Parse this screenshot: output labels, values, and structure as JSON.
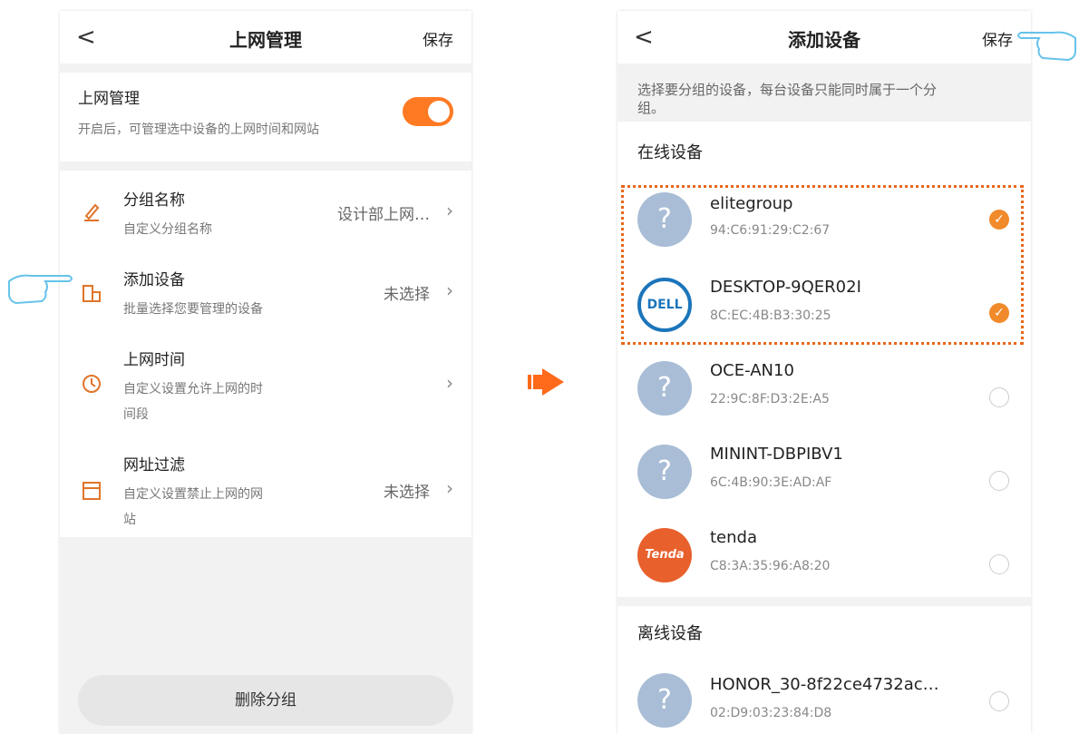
{
  "left": {
    "back": "<",
    "title": "上网管理",
    "save": "保存",
    "toggle": {
      "title": "上网管理",
      "desc": "开启后，可管理选中设备的上网时间和网站"
    },
    "items": [
      {
        "title": "分组名称",
        "sub": "自定义分组名称",
        "value": "设计部上网…"
      },
      {
        "title": "添加设备",
        "sub": "批量选择您要管理的设备",
        "value": "未选择"
      },
      {
        "title": "上网时间",
        "sub1": "自定义设置允许上网的时",
        "sub2": "间段",
        "value": ""
      },
      {
        "title": "网址过滤",
        "sub1": "自定义设置禁止上网的网",
        "sub2": "站",
        "value": "未选择"
      }
    ],
    "delete": "删除分组"
  },
  "right": {
    "back": "<",
    "title": "添加设备",
    "save": "保存",
    "tip": "选择要分组的设备，每台设备只能同时属于一个分",
    "tip2": "组。",
    "online": "在线设备",
    "offline": "离线设备",
    "devices": [
      {
        "name": "elitegroup",
        "mac": "94:C6:91:29:C2:67",
        "icon": "?",
        "checked": true
      },
      {
        "name": "DESKTOP-9QER02I",
        "mac": "8C:EC:4B:B3:30:25",
        "icon": "DELL",
        "checked": true
      },
      {
        "name": "OCE-AN10",
        "mac": "22:9C:8F:D3:2E:A5",
        "icon": "?",
        "checked": false
      },
      {
        "name": "MININT-DBPIBV1",
        "mac": "6C:4B:90:3E:AD:AF",
        "icon": "?",
        "checked": false
      },
      {
        "name": "tenda",
        "mac": "C8:3A:35:96:A8:20",
        "icon": "Tenda",
        "checked": false
      }
    ],
    "offline_device": {
      "name": "HONOR_30-8f22ce4732ac…",
      "mac": "02:D9:03:23:84:D8",
      "icon": "?"
    }
  },
  "colors": {
    "accent": "#ff7a23"
  }
}
